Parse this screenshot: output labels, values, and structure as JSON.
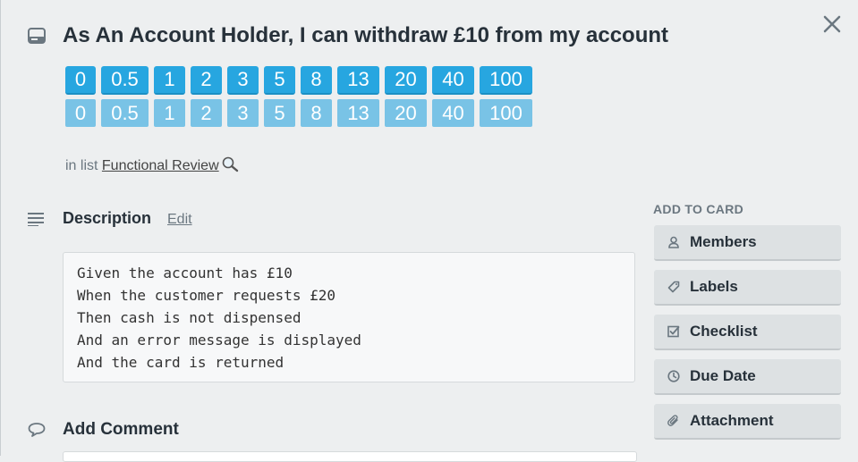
{
  "card": {
    "title": "As An Account Holder, I can withdraw £10 from my account"
  },
  "points": {
    "top": [
      {
        "label": "0",
        "w": 34
      },
      {
        "label": "0.5",
        "w": 53
      },
      {
        "label": "1",
        "w": 35
      },
      {
        "label": "2",
        "w": 35
      },
      {
        "label": "3",
        "w": 35
      },
      {
        "label": "5",
        "w": 35
      },
      {
        "label": "8",
        "w": 35
      },
      {
        "label": "13",
        "w": 47
      },
      {
        "label": "20",
        "w": 47
      },
      {
        "label": "40",
        "w": 47
      },
      {
        "label": "100",
        "w": 59
      }
    ],
    "bottom": [
      "0",
      "0.5",
      "1",
      "2",
      "3",
      "5",
      "8",
      "13",
      "20",
      "40",
      "100"
    ]
  },
  "list": {
    "prefix": "in list",
    "name": "Functional Review"
  },
  "description": {
    "title": "Description",
    "edit_label": "Edit",
    "lines": [
      "Given the account has £10",
      "When the customer requests £20",
      "Then cash is not dispensed",
      "And an error message is displayed",
      "And the card is returned"
    ]
  },
  "comment": {
    "title": "Add Comment"
  },
  "sidebar": {
    "heading": "ADD TO CARD",
    "buttons": [
      {
        "label": "Members",
        "icon": "person-icon"
      },
      {
        "label": "Labels",
        "icon": "tag-icon"
      },
      {
        "label": "Checklist",
        "icon": "checkbox-icon"
      },
      {
        "label": "Due Date",
        "icon": "clock-icon"
      },
      {
        "label": "Attachment",
        "icon": "paperclip-icon"
      }
    ]
  }
}
